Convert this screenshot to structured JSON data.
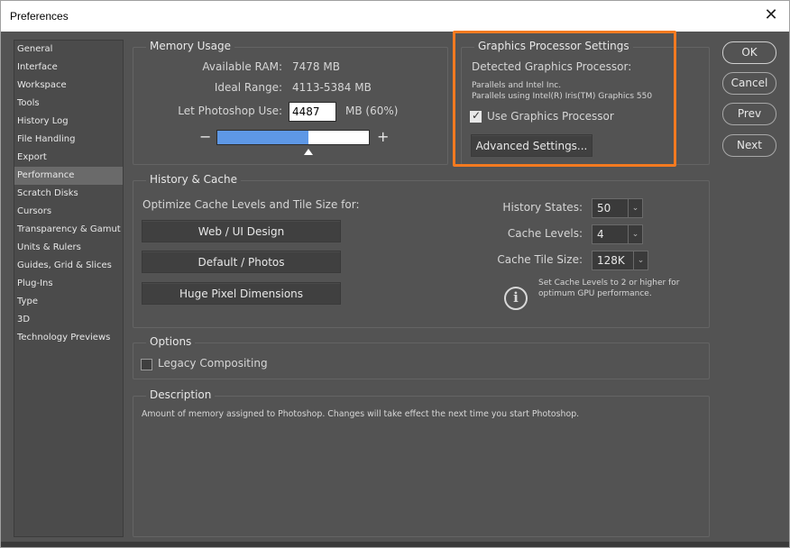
{
  "window": {
    "title": "Preferences",
    "close_glyph": "✕"
  },
  "sidebar": {
    "items": [
      {
        "label": "General"
      },
      {
        "label": "Interface"
      },
      {
        "label": "Workspace"
      },
      {
        "label": "Tools"
      },
      {
        "label": "History Log"
      },
      {
        "label": "File Handling"
      },
      {
        "label": "Export"
      },
      {
        "label": "Performance",
        "active": true
      },
      {
        "label": "Scratch Disks"
      },
      {
        "label": "Cursors"
      },
      {
        "label": "Transparency & Gamut"
      },
      {
        "label": "Units & Rulers"
      },
      {
        "label": "Guides, Grid & Slices"
      },
      {
        "label": "Plug-Ins"
      },
      {
        "label": "Type"
      },
      {
        "label": "3D"
      },
      {
        "label": "Technology Previews"
      }
    ]
  },
  "memory": {
    "legend": "Memory Usage",
    "available_label": "Available RAM:",
    "available_value": "7478 MB",
    "ideal_label": "Ideal Range:",
    "ideal_value": "4113-5384 MB",
    "use_label": "Let Photoshop Use:",
    "use_value": "4487",
    "use_unit": "MB (60%)",
    "slider_fraction": 0.6,
    "minus": "−",
    "plus": "+"
  },
  "gpu": {
    "legend": "Graphics Processor Settings",
    "detected_label": "Detected Graphics Processor:",
    "line1": "Parallels and Intel Inc.",
    "line2": "Parallels using Intel(R) Iris(TM) Graphics 550",
    "use_gpu_label": "Use Graphics Processor",
    "use_gpu_checked": true,
    "advanced_button": "Advanced Settings...",
    "highlight_color": "#f47a20"
  },
  "history": {
    "legend": "History & Cache",
    "optimize_label": "Optimize Cache Levels and Tile Size for:",
    "btn_web": "Web / UI Design",
    "btn_default": "Default / Photos",
    "btn_huge": "Huge Pixel Dimensions",
    "states_label": "History States:",
    "states_value": "50",
    "levels_label": "Cache Levels:",
    "levels_value": "4",
    "tile_label": "Cache Tile Size:",
    "tile_value": "128K",
    "note_line1": "Set Cache Levels to 2 or higher for",
    "note_line2": "optimum GPU performance.",
    "info_glyph": "i"
  },
  "options": {
    "legend": "Options",
    "legacy_label": "Legacy Compositing",
    "legacy_checked": false
  },
  "description": {
    "legend": "Description",
    "text": "Amount of memory assigned to Photoshop. Changes will take effect the next time you start Photoshop."
  },
  "actions": {
    "ok": "OK",
    "cancel": "Cancel",
    "prev": "Prev",
    "next": "Next"
  },
  "colors": {
    "slider_fill": "#5e98e6",
    "panel_bg": "#535353"
  }
}
